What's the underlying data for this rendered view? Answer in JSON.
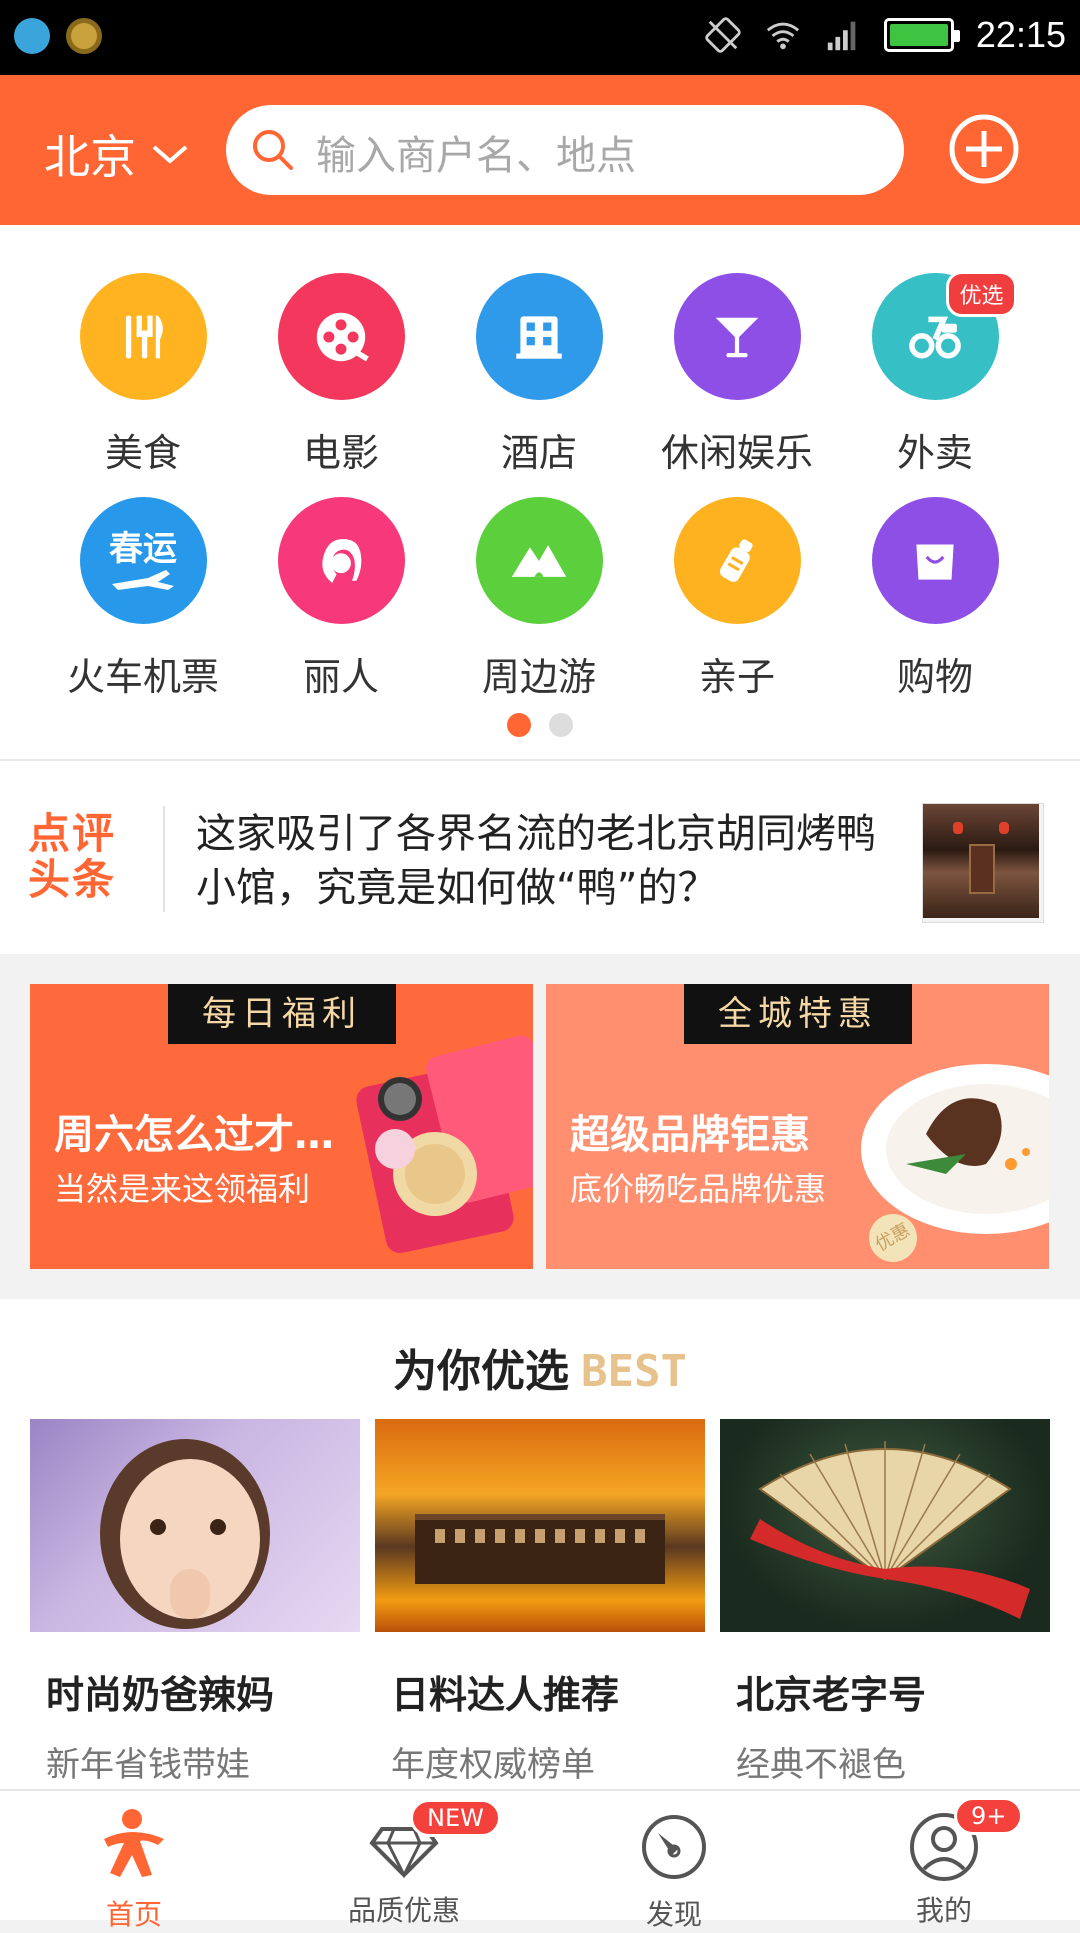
{
  "status_bar": {
    "time": "22:15"
  },
  "header": {
    "city": "北京",
    "search_placeholder": "输入商户名、地点"
  },
  "categories": [
    {
      "label": "美食",
      "icon": "cutlery-icon",
      "color": "#ffb320"
    },
    {
      "label": "电影",
      "icon": "film-reel-icon",
      "color": "#f4385d"
    },
    {
      "label": "酒店",
      "icon": "building-icon",
      "color": "#2f9aea"
    },
    {
      "label": "休闲娱乐",
      "icon": "cocktail-icon",
      "color": "#8e4fe6"
    },
    {
      "label": "外卖",
      "icon": "delivery-icon",
      "color": "#36c0c6",
      "badge": "优选"
    },
    {
      "label": "火车机票",
      "icon": "plane-icon",
      "color": "#2898ea",
      "icon_text": "春运"
    },
    {
      "label": "丽人",
      "icon": "woman-profile-icon",
      "color": "#f7387a"
    },
    {
      "label": "周边游",
      "icon": "mountain-icon",
      "color": "#5ccf3c"
    },
    {
      "label": "亲子",
      "icon": "baby-bottle-icon",
      "color": "#ffb220"
    },
    {
      "label": "购物",
      "icon": "shopping-bag-icon",
      "color": "#8e4fe6"
    }
  ],
  "pager": {
    "count": 2,
    "active": 0
  },
  "headline": {
    "logo_line1": "点评",
    "logo_line2": "头条",
    "text": "这家吸引了各界名流的老北京胡同烤鸭小馆，究竟是如何做“鸭”的？"
  },
  "promos": [
    {
      "tag": "每日福利",
      "title": "周六怎么过才…",
      "subtitle": "当然是来这领福利"
    },
    {
      "tag": "全城特惠",
      "title": "超级品牌钜惠",
      "subtitle": "底价畅吃品牌优惠",
      "seal_text": "优惠"
    }
  ],
  "best": {
    "title": "为你优选",
    "title_en": "BEST",
    "items": [
      {
        "name": "时尚奶爸辣妈",
        "desc": "新年省钱带娃"
      },
      {
        "name": "日料达人推荐",
        "desc": "年度权威榜单"
      },
      {
        "name": "北京老字号",
        "desc": "经典不褪色"
      }
    ]
  },
  "tabs": [
    {
      "label": "首页",
      "icon": "home-person-icon",
      "active": true
    },
    {
      "label": "品质优惠",
      "icon": "diamond-icon",
      "badge": "NEW"
    },
    {
      "label": "发现",
      "icon": "compass-icon"
    },
    {
      "label": "我的",
      "icon": "user-icon",
      "badge": "9+"
    }
  ],
  "colors": {
    "accent": "#ff6633",
    "badge_red": "#f5413c",
    "best_gold": "#e7c28c"
  }
}
